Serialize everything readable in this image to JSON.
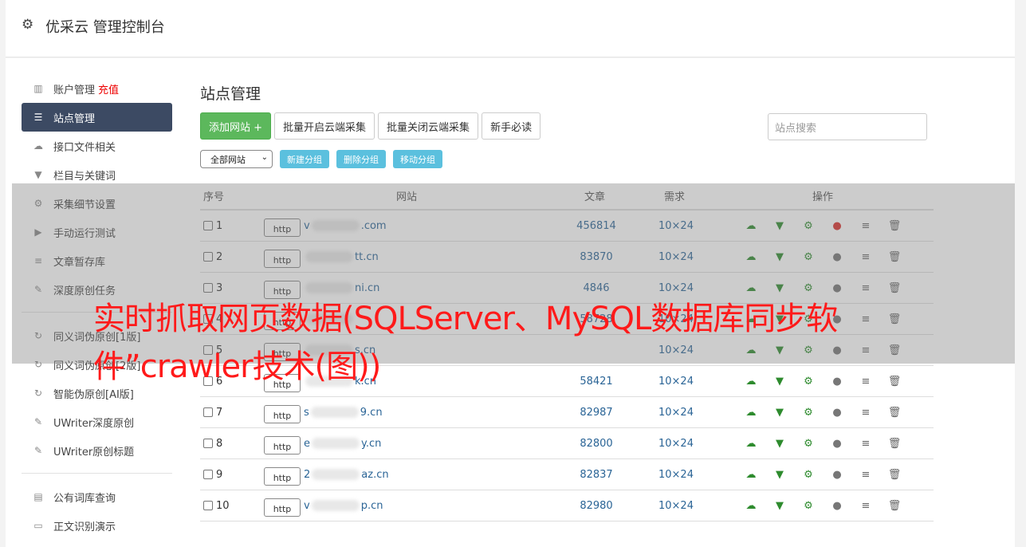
{
  "header": {
    "title": "优采云 管理控制台"
  },
  "sidebar": {
    "items": [
      {
        "label": "账户管理",
        "extra": "充值",
        "icon": "bar-chart-icon"
      },
      {
        "label": "站点管理",
        "icon": "server-icon",
        "active": true
      },
      {
        "label": "接口文件相关",
        "icon": "cloud-upload-icon"
      },
      {
        "label": "栏目与关键词",
        "icon": "filter-icon"
      },
      {
        "label": "采集细节设置",
        "icon": "cogs-icon"
      },
      {
        "label": "手动运行测试",
        "icon": "play-circle-icon"
      },
      {
        "label": "文章暂存库",
        "icon": "database-icon"
      },
      {
        "label": "深度原创任务",
        "icon": "edit-icon"
      }
    ],
    "group2": [
      {
        "label": "同义词伪原创[1版]",
        "icon": "refresh-icon"
      },
      {
        "label": "同义词伪原创[2版]",
        "icon": "refresh-icon"
      },
      {
        "label": "智能伪原创[AI版]",
        "icon": "refresh-icon"
      },
      {
        "label": "UWriter深度原创",
        "icon": "edit-icon"
      },
      {
        "label": "UWriter原创标题",
        "icon": "edit-icon"
      }
    ],
    "group3": [
      {
        "label": "公有词库查询",
        "icon": "book-icon"
      },
      {
        "label": "正文识别演示",
        "icon": "desktop-icon"
      }
    ]
  },
  "main": {
    "title": "站点管理",
    "buttons": {
      "add": "添加网站 +",
      "batch_on": "批量开启云端采集",
      "batch_off": "批量关闭云端采集",
      "guide": "新手必读"
    },
    "search_placeholder": "站点搜索",
    "group_select": "全部网站",
    "group_buttons": {
      "new": "新建分组",
      "delete": "删除分组",
      "move": "移动分组"
    },
    "table": {
      "headers": {
        "no": "序号",
        "site": "网站",
        "articles": "文章",
        "demand": "需求",
        "ops": "操作"
      },
      "http_label": "http",
      "rows": [
        {
          "no": "1",
          "prefix": "v",
          "suffix": ".com",
          "articles": "456814",
          "demand": "10×24",
          "running": true
        },
        {
          "no": "2",
          "prefix": "",
          "suffix": "tt.cn",
          "articles": "83870",
          "demand": "10×24"
        },
        {
          "no": "3",
          "prefix": "",
          "suffix": "ni.cn",
          "articles": "4846",
          "demand": "10×24"
        },
        {
          "no": "4",
          "prefix": "",
          "suffix": "",
          "articles": "58728",
          "demand": "10×24"
        },
        {
          "no": "5",
          "prefix": "",
          "suffix": "s.cn",
          "articles": "",
          "demand": "10×24"
        },
        {
          "no": "6",
          "prefix": "",
          "suffix": "k.cn",
          "articles": "58421",
          "demand": "10×24"
        },
        {
          "no": "7",
          "prefix": "s",
          "suffix": "9.cn",
          "articles": "82987",
          "demand": "10×24"
        },
        {
          "no": "8",
          "prefix": "e",
          "suffix": "y.cn",
          "articles": "82800",
          "demand": "10×24"
        },
        {
          "no": "9",
          "prefix": "2",
          "suffix": "az.cn",
          "articles": "82837",
          "demand": "10×24"
        },
        {
          "no": "10",
          "prefix": "v",
          "suffix": "p.cn",
          "articles": "82980",
          "demand": "10×24"
        }
      ]
    }
  },
  "overlay_text": "实时抓取网页数据(SQLServer、MySQL数据库同步软件”crawler技术(图))"
}
